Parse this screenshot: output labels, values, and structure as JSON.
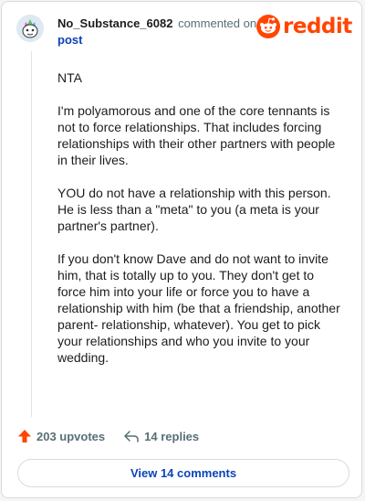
{
  "header": {
    "username": "No_Substance_6082",
    "commented_on": "commented on",
    "post_link": "post",
    "brand": "reddit"
  },
  "comment": {
    "paragraphs": [
      "NTA",
      "I'm polyamorous and one of the core tennants is not to force relationships. That includes forcing relationships with their other partners with people in their lives.",
      "YOU do not have a relationship with this person. He is less than a \"meta\" to you (a meta is your partner's partner).",
      "If you don't know Dave and do not want to invite him, that is totally up to you. They don't get to force him into your life or force you to have a relationship with him (be that a friendship, another parent- relationship, whatever). You get to pick your relationships and who you invite to your wedding."
    ]
  },
  "actions": {
    "upvotes": "203 upvotes",
    "replies": "14 replies"
  },
  "footer": {
    "view_comments": "View 14 comments"
  },
  "colors": {
    "brand": "#ff4500",
    "link": "#0a44b8",
    "muted": "#576f76"
  },
  "icons": [
    "avatar-icon",
    "reddit-snoo-icon",
    "upvote-arrow-icon",
    "reply-icon"
  ]
}
